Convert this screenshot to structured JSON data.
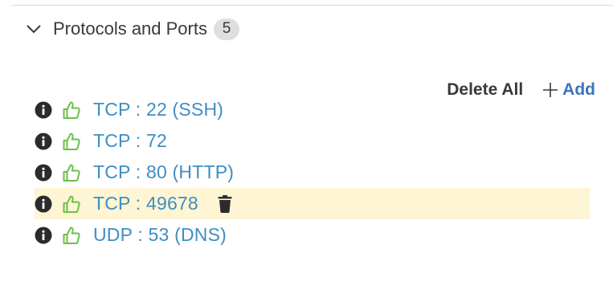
{
  "section": {
    "title": "Protocols and Ports",
    "count": "5",
    "expanded_icon": "chevron-down-icon"
  },
  "actions": {
    "delete_all_label": "Delete All",
    "add_label": "Add",
    "add_icon": "plus-icon"
  },
  "rules": [
    {
      "label": "TCP : 22 (SSH)",
      "status_icon": "thumbs-up-icon",
      "info_icon": "info-icon"
    },
    {
      "label": "TCP : 72",
      "status_icon": "thumbs-up-icon",
      "info_icon": "info-icon"
    },
    {
      "label": "TCP : 80 (HTTP)",
      "status_icon": "thumbs-up-icon",
      "info_icon": "info-icon"
    },
    {
      "label": "TCP : 49678",
      "status_icon": "thumbs-up-icon",
      "info_icon": "info-icon",
      "hovered": true,
      "hover_action_icon": "trash-icon"
    },
    {
      "label": "UDP : 53 (DNS)",
      "status_icon": "thumbs-up-icon",
      "info_icon": "info-icon"
    }
  ],
  "colors": {
    "link_blue": "#3e8ec3",
    "add_blue": "#3a74b8",
    "allow_green": "#6cc04a",
    "text_dark": "#39393b",
    "hover_row_bg": "#fdf5d3",
    "badge_bg": "#dfdfdf"
  }
}
